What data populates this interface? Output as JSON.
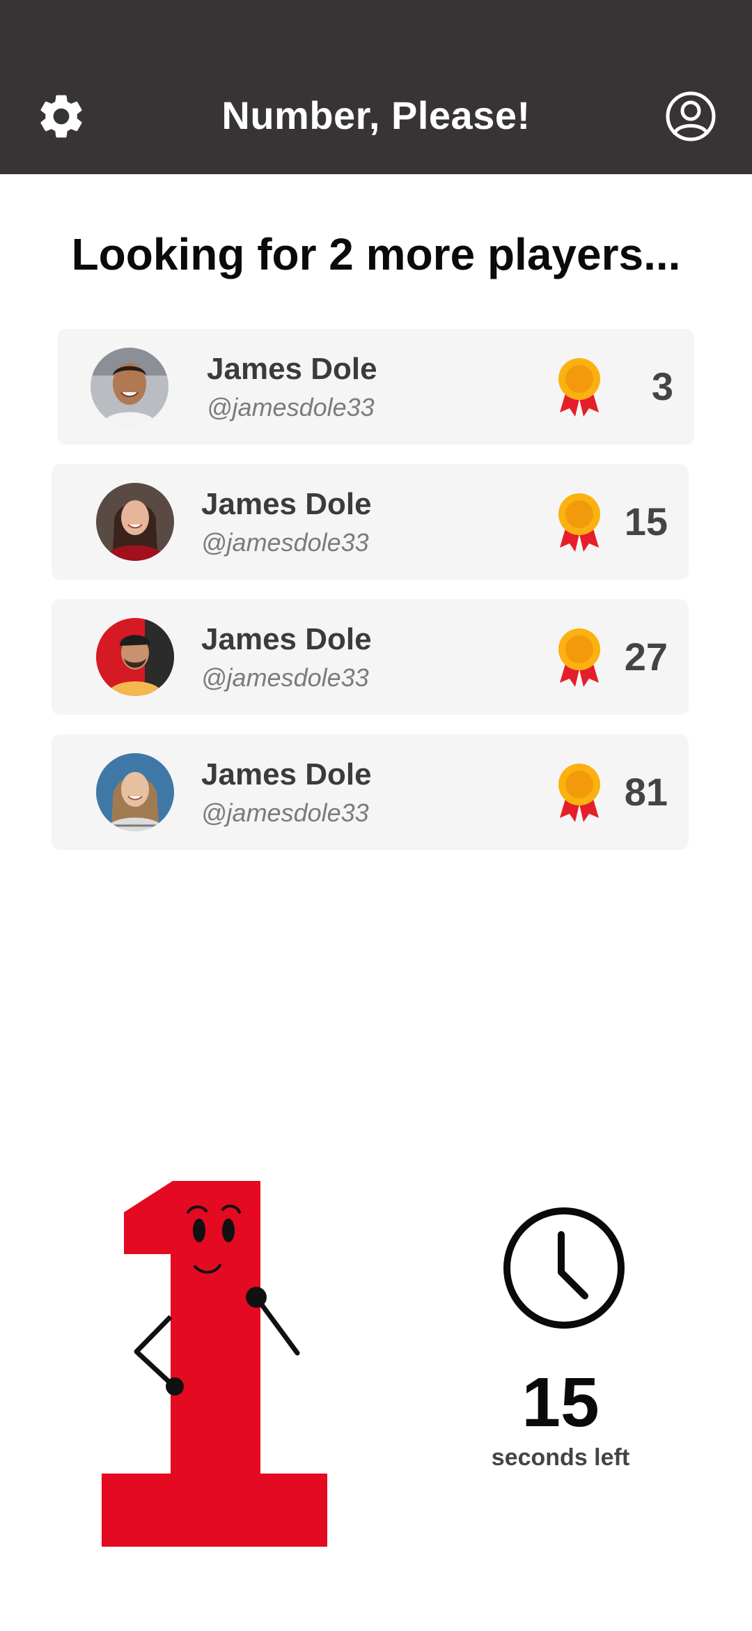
{
  "header": {
    "title": "Number, Please!",
    "settings_icon": "gear-icon",
    "profile_icon": "user-circle-icon",
    "background": "#383435"
  },
  "lobby": {
    "status": "Looking for 2 more players..."
  },
  "players": [
    {
      "name": "James Dole",
      "handle": "@jamesdole33",
      "score": "3"
    },
    {
      "name": "James Dole",
      "handle": "@jamesdole33",
      "score": "15"
    },
    {
      "name": "James Dole",
      "handle": "@jamesdole33",
      "score": "27"
    },
    {
      "name": "James Dole",
      "handle": "@jamesdole33",
      "score": "81"
    }
  ],
  "timer": {
    "seconds": "15",
    "label": "seconds left",
    "icon": "clock-icon"
  },
  "mascot": {
    "icon": "number-one-mascot",
    "color": "#e30a21"
  },
  "colors": {
    "card_background": "#f5f5f5",
    "medal_gold": "#fbb110",
    "medal_ribbon": "#e51f2a"
  }
}
